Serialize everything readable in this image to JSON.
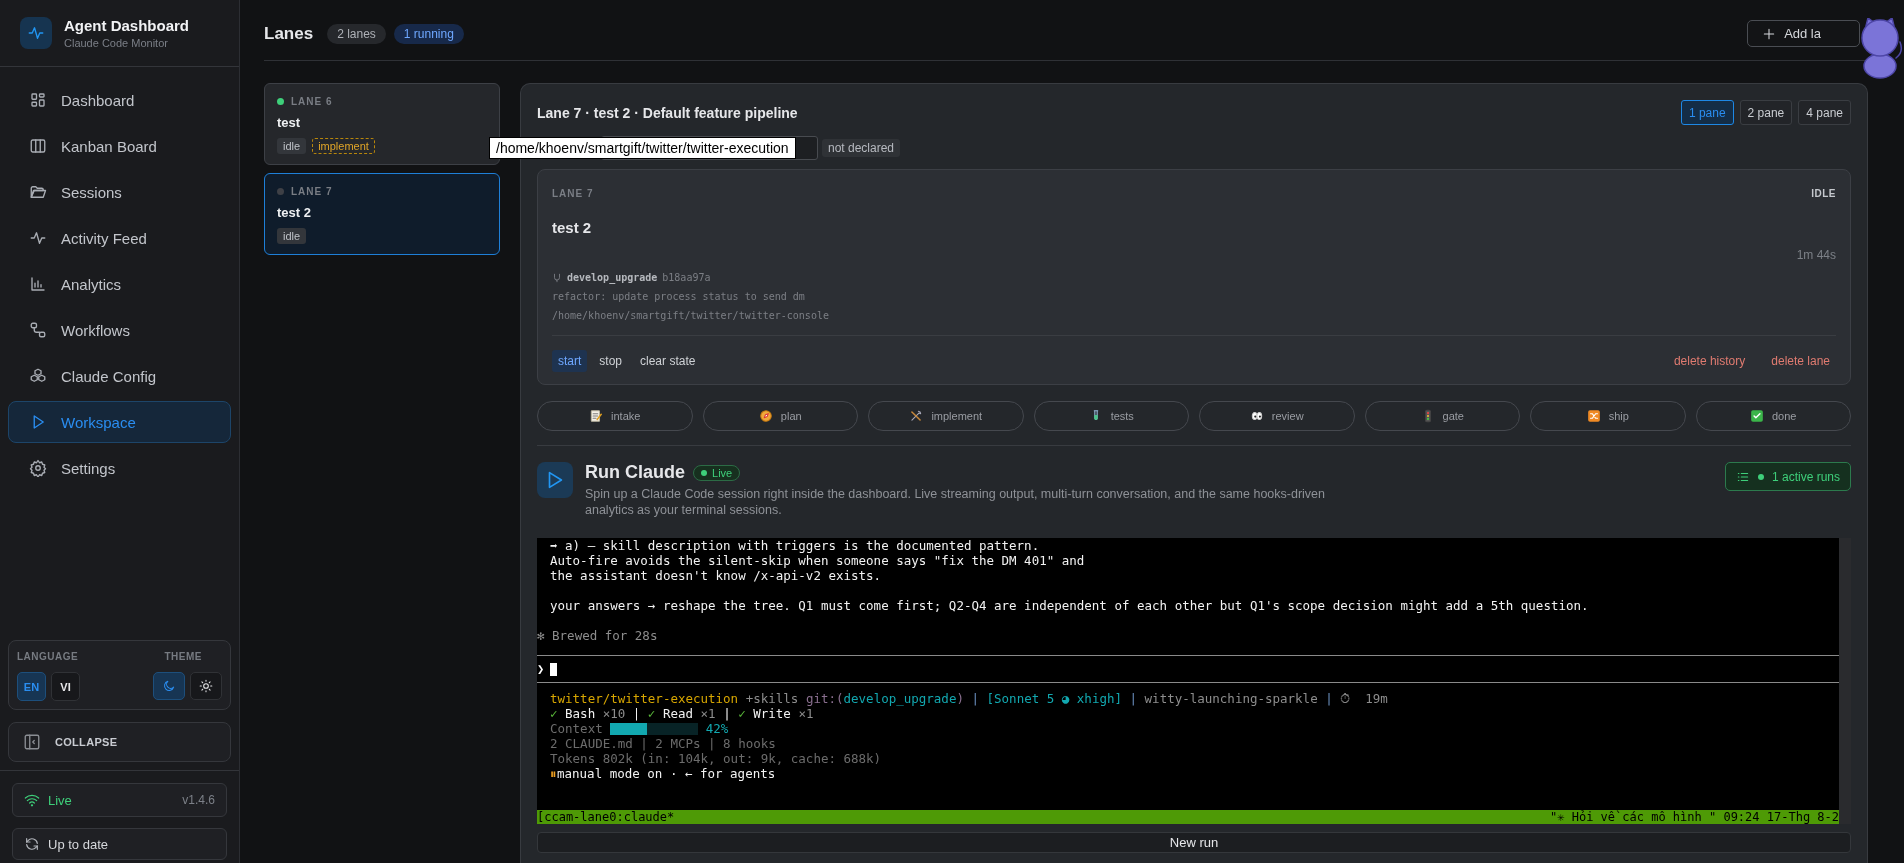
{
  "sidebar": {
    "brand": {
      "title": "Agent Dashboard",
      "subtitle": "Claude Code Monitor"
    },
    "items": [
      {
        "label": "Dashboard",
        "selected": false
      },
      {
        "label": "Kanban Board",
        "selected": false
      },
      {
        "label": "Sessions",
        "selected": false
      },
      {
        "label": "Activity Feed",
        "selected": false
      },
      {
        "label": "Analytics",
        "selected": false
      },
      {
        "label": "Workflows",
        "selected": false
      },
      {
        "label": "Claude Config",
        "selected": false
      },
      {
        "label": "Workspace",
        "selected": true
      },
      {
        "label": "Settings",
        "selected": false
      }
    ],
    "language": {
      "label": "LANGUAGE",
      "options": [
        {
          "label": "EN",
          "selected": true
        },
        {
          "label": "VI",
          "selected": false
        }
      ]
    },
    "theme": {
      "label": "THEME",
      "options": [
        {
          "kind": "dark",
          "selected": true
        },
        {
          "kind": "light",
          "selected": false
        }
      ]
    },
    "collapse": "COLLAPSE",
    "connection": {
      "label": "Live",
      "version": "v1.4.6"
    },
    "update": "Up to date"
  },
  "header": {
    "title": "Lanes",
    "badges": [
      {
        "text": "2 lanes",
        "kind": "count"
      },
      {
        "text": "1 running",
        "kind": "running"
      }
    ],
    "add_button": "Add la"
  },
  "lanes": [
    {
      "label": "LANE 6",
      "name": "test",
      "running": true,
      "selected": false,
      "tags": [
        {
          "text": "idle",
          "kind": "status"
        },
        {
          "text": "implement",
          "kind": "stage"
        }
      ]
    },
    {
      "label": "LANE 7",
      "name": "test 2",
      "running": false,
      "selected": true,
      "tags": [
        {
          "text": "idle",
          "kind": "status"
        }
      ]
    }
  ],
  "panel": {
    "title": "Lane 7 · test 2 · Default feature pipeline",
    "panes": [
      {
        "label": "1 pane",
        "selected": true
      },
      {
        "label": "2 pane",
        "selected": false
      },
      {
        "label": "4 pane",
        "selected": false
      }
    ],
    "declared": "not declared",
    "tooltip": "/home/khoenv/smartgift/twitter/twitter-execution",
    "lane_card": {
      "label": "LANE 7",
      "status": "IDLE",
      "name": "test 2",
      "elapsed": "1m 44s",
      "branch": "develop_upgrade",
      "commit": "b18aa97a",
      "message": "refactor: update process status to send dm",
      "path": "/home/khoenv/smartgift/twitter/twitter-console",
      "actions": [
        {
          "label": "start",
          "kind": "primary"
        },
        {
          "label": "stop",
          "kind": "plain"
        },
        {
          "label": "clear state",
          "kind": "plain"
        },
        {
          "label": "delete history",
          "kind": "danger"
        },
        {
          "label": "delete lane",
          "kind": "danger"
        }
      ]
    },
    "stages": [
      {
        "label": "intake"
      },
      {
        "label": "plan"
      },
      {
        "label": "implement"
      },
      {
        "label": "tests"
      },
      {
        "label": "review"
      },
      {
        "label": "gate"
      },
      {
        "label": "ship"
      },
      {
        "label": "done"
      }
    ],
    "run": {
      "title": "Run Claude",
      "badge": "Live",
      "description": "Spin up a Claude Code session right inside the dashboard. Live streaming output, multi-turn conversation, and the same hooks-driven analytics as your terminal sessions.",
      "active_runs": "1 active runs"
    },
    "terminal": {
      "output": [
        {
          "kind": "text",
          "segments": [
            {
              "kind": "plain",
              "text": "➡ a) — skill description with triggers is the documented pattern."
            }
          ]
        },
        {
          "kind": "text",
          "segments": [
            {
              "kind": "plain",
              "text": "Auto-fire avoids the silent-skip when someone says \"fix the DM 401\" and"
            }
          ]
        },
        {
          "kind": "text",
          "segments": [
            {
              "kind": "plain",
              "text": "the assistant doesn't know /x-api-v2 exists."
            }
          ]
        },
        {
          "kind": "blank"
        },
        {
          "kind": "text",
          "segments": [
            {
              "kind": "plain",
              "text": "your answers → reshape the tree. Q1 must come first; Q2-Q4 are independent of each other but Q1's scope decision might add a 5th question."
            }
          ]
        },
        {
          "kind": "blank"
        },
        {
          "kind": "note",
          "segments": [
            {
              "kind": "dim",
              "text": "✻ Brewed for 28s"
            }
          ]
        }
      ],
      "prompt": "❯",
      "status_lines": [
        {
          "segments": [
            {
              "kind": "path",
              "text": "twitter/twitter-execution"
            },
            {
              "kind": "dim",
              "text": " +skills "
            },
            {
              "kind": "git",
              "text": "git:("
            },
            {
              "kind": "cyan",
              "text": "develop_upgrade"
            },
            {
              "kind": "git",
              "text": ")"
            },
            {
              "kind": "sep",
              "text": " | "
            },
            {
              "kind": "cyan",
              "text": "[Sonnet 5 ◕ xhigh]"
            },
            {
              "kind": "sep",
              "text": " | "
            },
            {
              "kind": "dim",
              "text": "witty-launching-sparkle"
            },
            {
              "kind": "sep",
              "text": " | "
            },
            {
              "kind": "dim",
              "text": "⏱  19m"
            }
          ]
        },
        {
          "segments": [
            {
              "kind": "green",
              "text": "✓"
            },
            {
              "kind": "plain",
              "text": " Bash"
            },
            {
              "kind": "dim",
              "text": " ×10"
            },
            {
              "kind": "plain",
              "text": " | "
            },
            {
              "kind": "green",
              "text": "✓"
            },
            {
              "kind": "plain",
              "text": " Read"
            },
            {
              "kind": "dim",
              "text": " ×1"
            },
            {
              "kind": "plain",
              "text": " | "
            },
            {
              "kind": "green",
              "text": "✓"
            },
            {
              "kind": "plain",
              "text": " Write"
            },
            {
              "kind": "dim",
              "text": " ×1"
            }
          ]
        },
        {
          "segments": [
            {
              "kind": "faint",
              "text": "Context "
            },
            {
              "kind": "meter",
              "level": 0.42
            },
            {
              "kind": "cyan",
              "text": " 42%"
            }
          ]
        },
        {
          "segments": [
            {
              "kind": "faint",
              "text": "2 CLAUDE.md | 2 MCPs | 8 hooks"
            }
          ]
        },
        {
          "segments": [
            {
              "kind": "faint",
              "text": "Tokens 802k (in: 104k, out: 9k, cache: 688k)"
            }
          ]
        },
        {
          "segments": [
            {
              "kind": "pause",
              "text": "⏸"
            },
            {
              "kind": "plain",
              "text": "manual mode on · ← for agents"
            }
          ]
        }
      ],
      "tmux_bar": {
        "left": "[ccam-lane0:claude*",
        "right": "\"✳ Hỏi về các mô hình \" 09:24 17-Thg 8-2"
      }
    },
    "new_run": "New run"
  }
}
